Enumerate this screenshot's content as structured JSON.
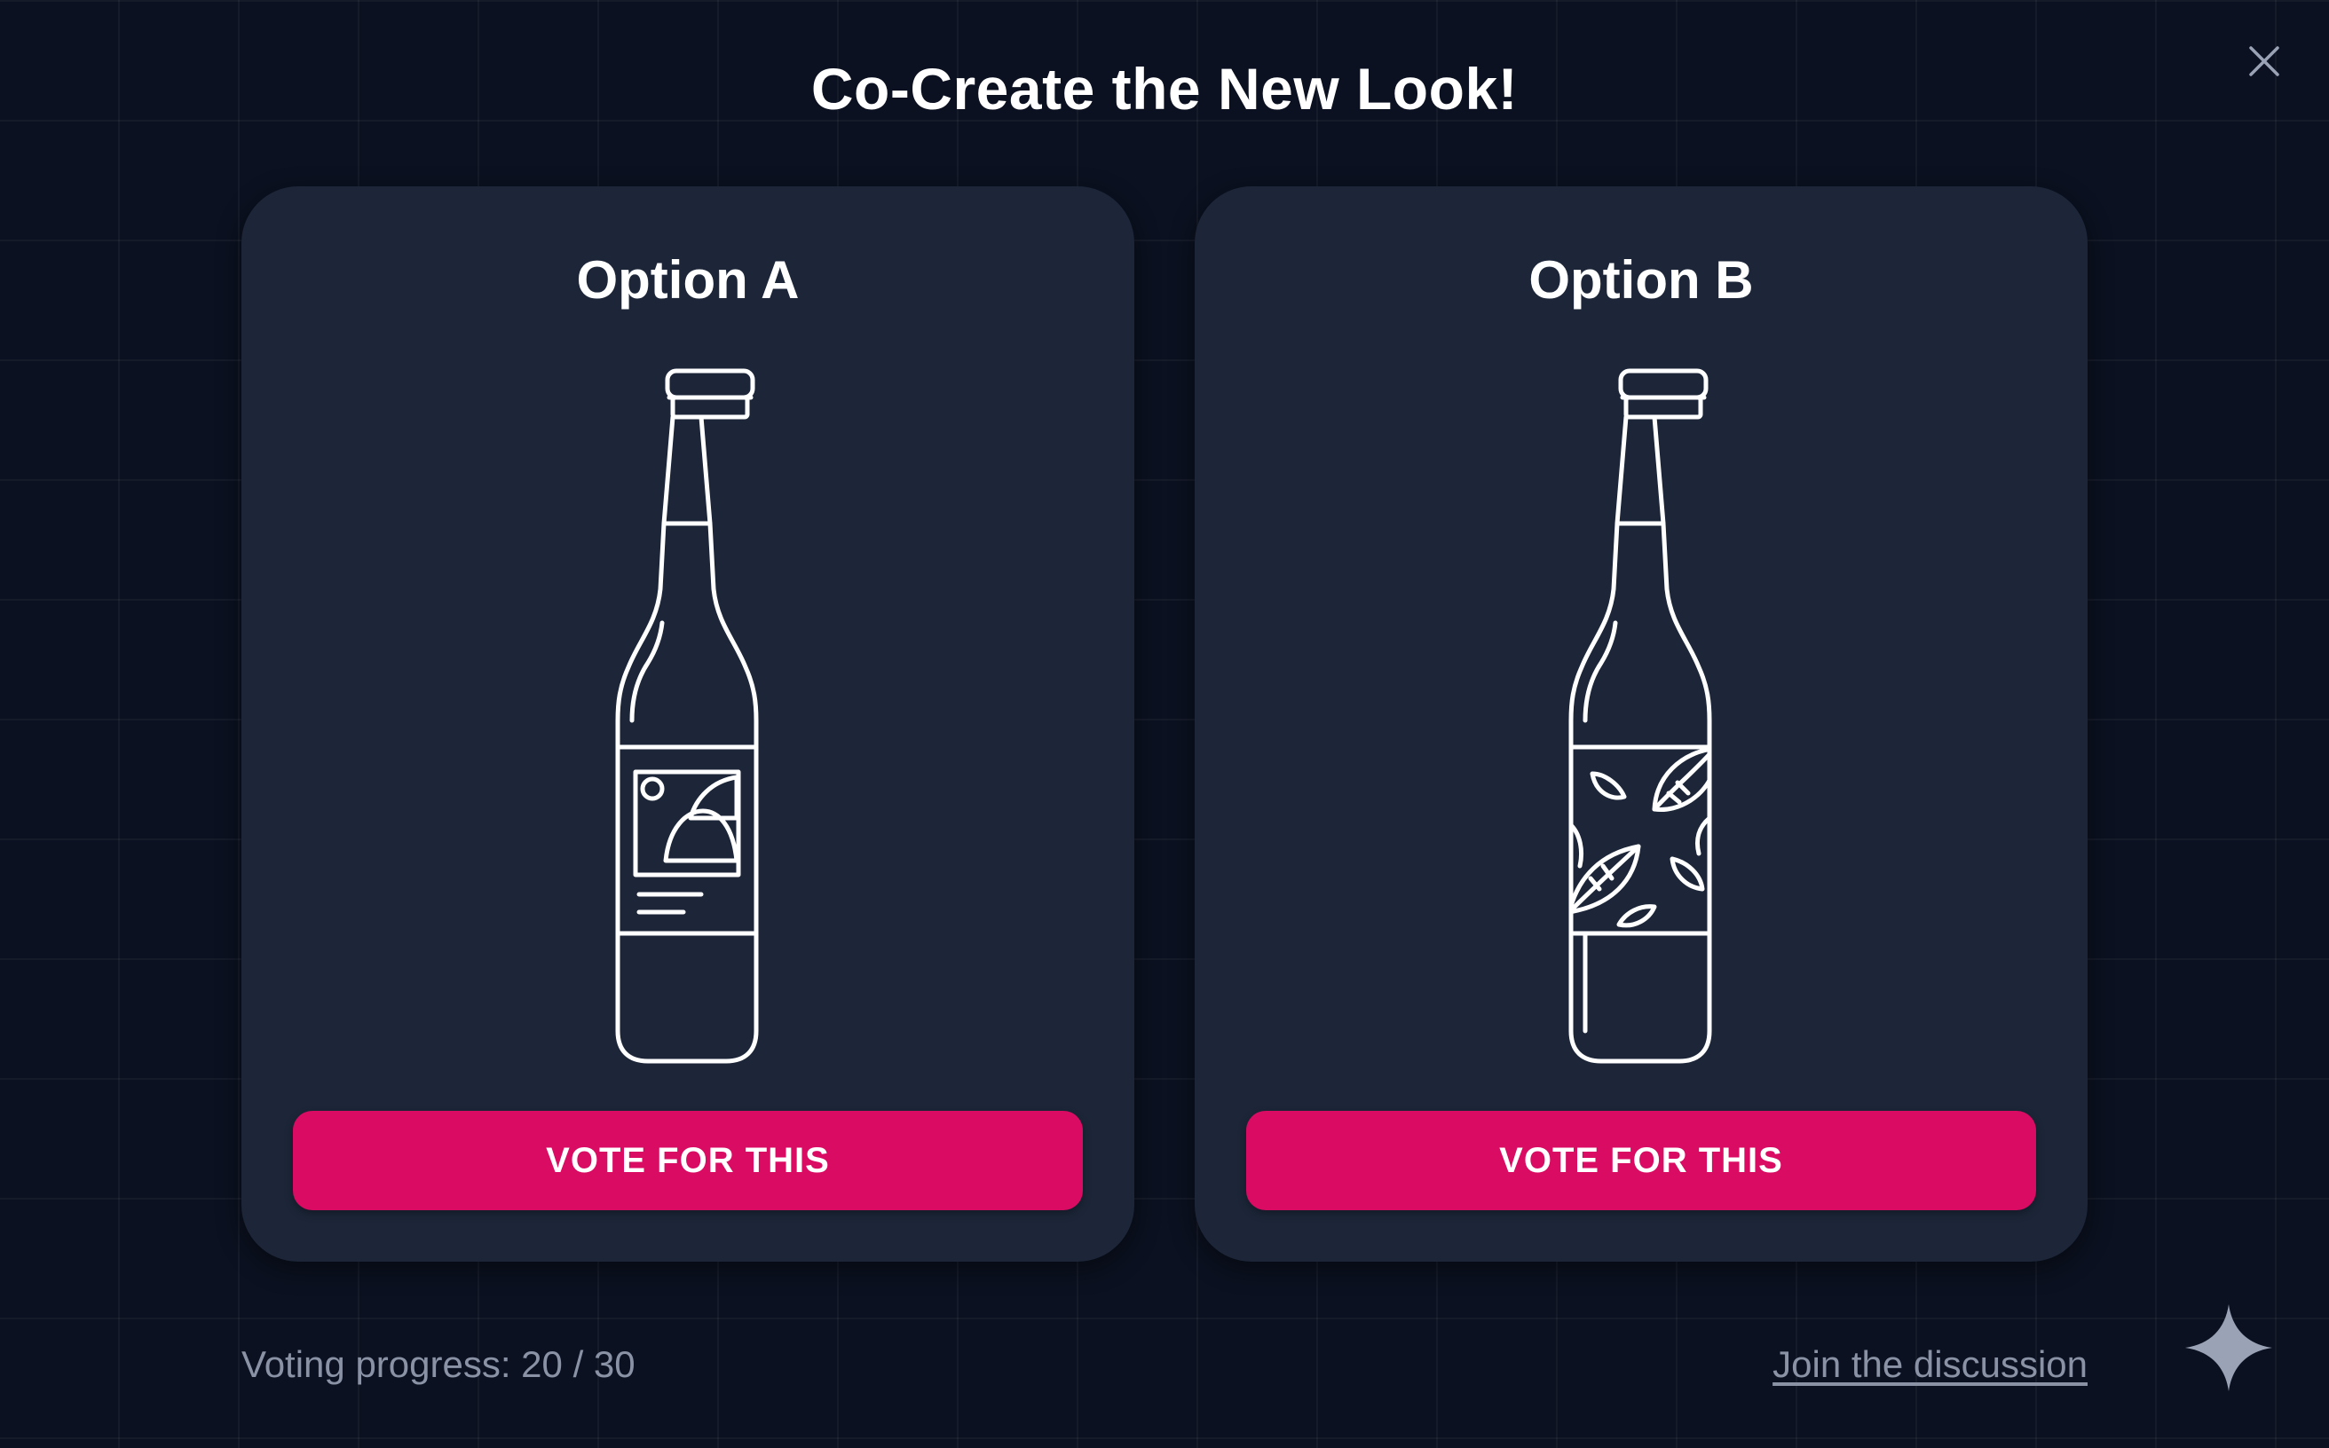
{
  "header": {
    "title": "Co-Create the New Look!"
  },
  "close_icon": "close-icon",
  "options": [
    {
      "title": "Option A",
      "label_style": "landscape-graphic",
      "vote_label": "VOTE FOR THIS"
    },
    {
      "title": "Option B",
      "label_style": "leaf-pattern",
      "vote_label": "VOTE FOR THIS"
    }
  ],
  "footer": {
    "progress_text": "Voting progress: 20 / 30",
    "votes_cast": 20,
    "votes_total": 30,
    "join_link": "Join the discussion"
  },
  "sparkle_icon": "sparkle-icon",
  "colors": {
    "background": "#0b1120",
    "card": "#1c2638",
    "accent": "#d90b63",
    "muted_text": "#8a93a6"
  }
}
